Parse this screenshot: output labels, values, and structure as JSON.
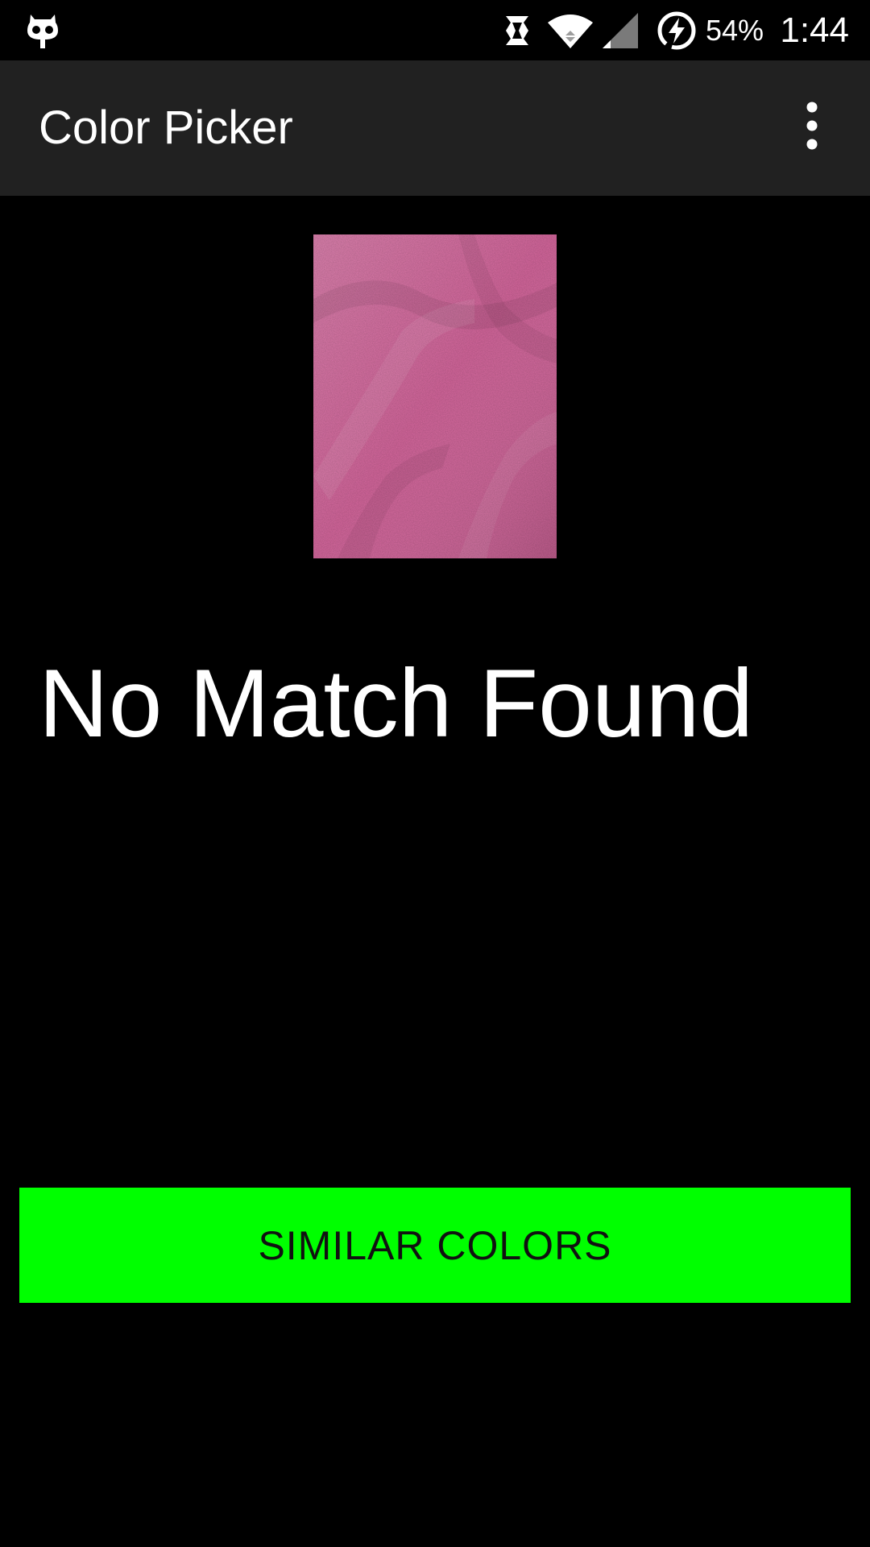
{
  "status_bar": {
    "battery_percent": "54%",
    "time": "1:44",
    "icons": [
      "cyanogen-icon",
      "sync-icon",
      "wifi-icon",
      "cell-signal-icon",
      "battery-charging-icon"
    ]
  },
  "app_bar": {
    "title": "Color Picker",
    "overflow_icon": "more-vert-icon"
  },
  "main": {
    "sample_image": {
      "description_icon": "fabric-swatch-image",
      "sampled_color": "#D8689F"
    },
    "result_text": "No Match Found",
    "similar_colors_button": "SIMILAR COLORS"
  },
  "colors": {
    "background": "#000000",
    "app_bar": "#212121",
    "button": "#00FF00",
    "button_text": "#111111",
    "text": "#FFFFFF"
  }
}
